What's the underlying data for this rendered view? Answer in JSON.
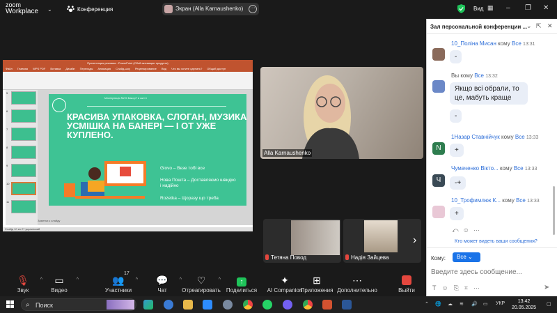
{
  "topbar": {
    "app_line1": "zoom",
    "app_line2": "Workplace",
    "conference_label": "Конференция",
    "share_label": "Экран (Alla Karnaushenko)",
    "view_label": "Вид"
  },
  "slide_window": {
    "title": "Презентация реклама - PowerPoint (Сбой активации продукта)",
    "tabs": [
      "Файл",
      "Главная",
      "WPS PDF",
      "Вставка",
      "Дизайн",
      "Переходы",
      "Анимация",
      "Слайд-шоу",
      "Рецензирование",
      "Вид",
      "Что вы хотите сделать?",
      "Общий доступ"
    ],
    "slide_header": "Маніпуляція №76 Бакор7 в житті",
    "slide_title": "КРАСИВА УПАКОВКА, СЛОГАН, МУЗИКА, УСМІШКА НА БАНЕРІ — І ОТ УЖЕ КУПЛЕНО.",
    "items": [
      "Glovo – Везе тобі все",
      "Нова Пошта – Доставляємо швидко і надійно",
      "Rozetka – Щоразу що треба"
    ],
    "notes": "Заметки к слайду",
    "status": "Слайд 10 из 27   украинский",
    "thumb_numbers": [
      "5",
      "6",
      "7",
      "8",
      "9",
      "10",
      "11"
    ]
  },
  "videos": {
    "main_name": "Alla Karnaushenko",
    "tile1_name": "Тетяна Повод",
    "tile2_name": "Надія Зайцева"
  },
  "toolbar": {
    "mute": "Звук",
    "video": "Видео",
    "participants": "Участники",
    "participants_count": "17",
    "chat": "Чат",
    "react": "Отреагировать",
    "share": "Поделиться",
    "ai": "AI Companion",
    "apps": "Приложения",
    "more": "Дополнительно",
    "leave": "Выйти"
  },
  "chat": {
    "title": "Зал персональной конференции ...",
    "to_word": "кому",
    "all_word": "Все",
    "messages": [
      {
        "name": "10_Поліна Мисан",
        "time": "13:31",
        "text": "-"
      },
      {
        "name": "Вы",
        "time": "13:32",
        "text": "Якщо всі обрали, то це, мабуть краще",
        "text2": "-"
      },
      {
        "name": "1Назар Ставнійчук",
        "time": "13:33",
        "text": "+",
        "avatar": "N"
      },
      {
        "name": "Чумаченко Вікто...",
        "time": "13:33",
        "text": "-+",
        "avatar": "Ч"
      },
      {
        "name": "10_Трофимлюк К...",
        "time": "13:33",
        "text": "+"
      }
    ],
    "who_can_see": "Кто может видеть ваши сообщения?",
    "to_label": "Кому:",
    "to_value": "Все",
    "input_placeholder": "Введите здесь сообщение..."
  },
  "taskbar": {
    "search": "Поиск",
    "lang": "УКР",
    "time": "13:42",
    "date": "20.05.2025"
  },
  "colors": {
    "slide_green": "#3ec394",
    "ppt_orange": "#c0532f",
    "zoom_blue": "#1a73e8",
    "share_green": "#1fc45a",
    "mute_red": "#e4473e"
  }
}
